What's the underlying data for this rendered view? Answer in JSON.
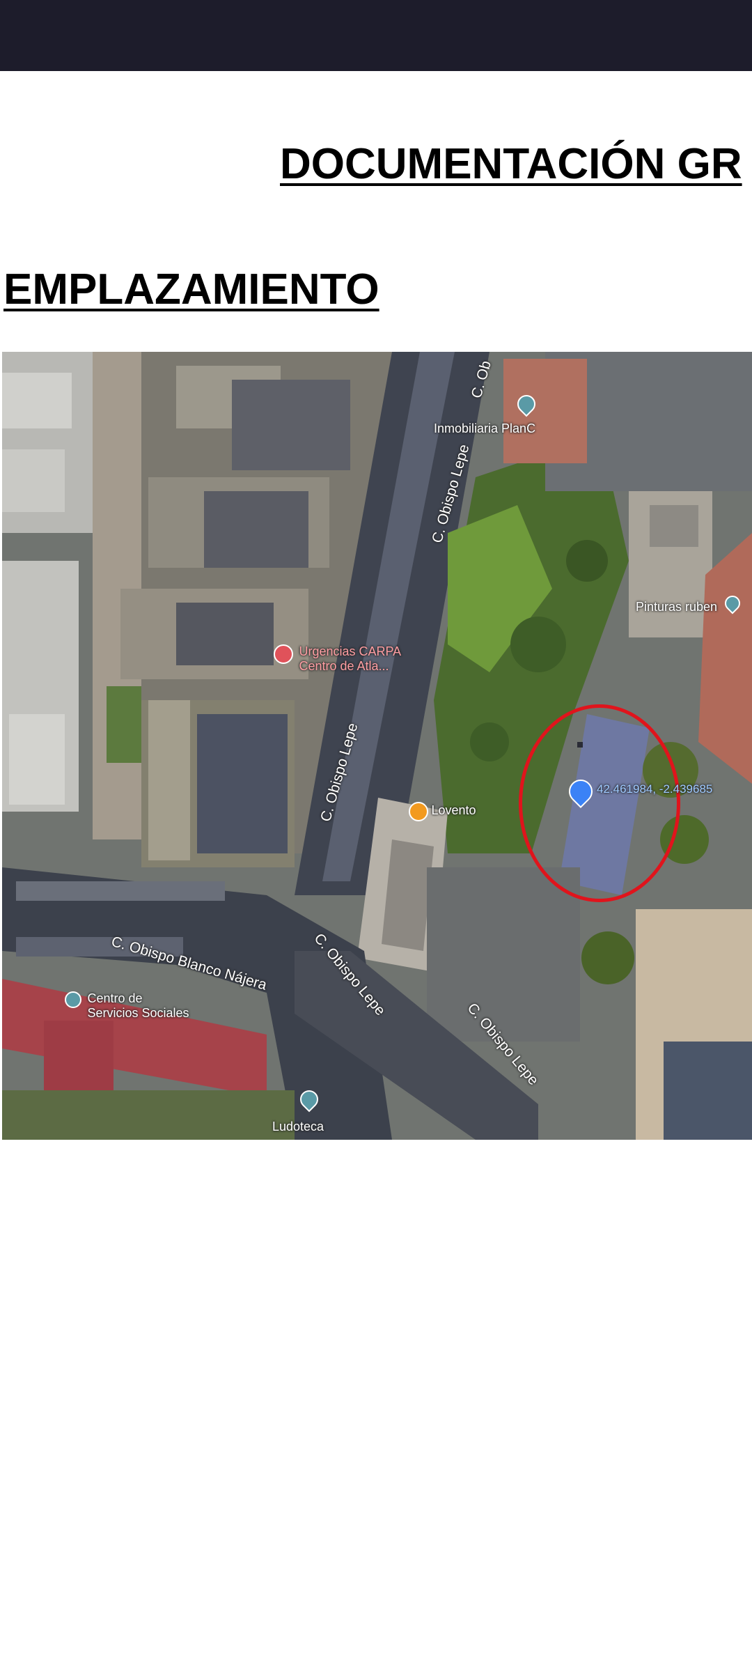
{
  "document": {
    "title": "DOCUMENTACIÓN GR",
    "section_title": "EMPLAZAMIENTO"
  },
  "map": {
    "streets": [
      {
        "name": "C. Obispo Lepe"
      },
      {
        "name": "C. Obispo Lepe"
      },
      {
        "name": "C. Obispo Blanco Nájera"
      },
      {
        "name": "C. Obispo Lepe"
      },
      {
        "name": "C. Obispo Lepe"
      },
      {
        "name": "C. Ob"
      }
    ],
    "places": [
      {
        "name": "Inmobiliaria PlanC",
        "icon": "pin-icon"
      },
      {
        "name": "Pinturas ruben",
        "icon": "pin-icon"
      },
      {
        "name": "Urgencias CARPA",
        "name2": "Centro de Atla...",
        "icon": "hospital-icon"
      },
      {
        "name": "Lovento",
        "icon": "trophy-icon"
      },
      {
        "name": "Centro de",
        "name2": "Servicios Sociales",
        "icon": "building-icon"
      },
      {
        "name": "Ludoteca",
        "icon": "pin-icon"
      }
    ],
    "marker": {
      "coordinates": "42.461984, -2.439685",
      "icon": "location-pin-icon",
      "highlight_color": "#e0141c"
    }
  }
}
